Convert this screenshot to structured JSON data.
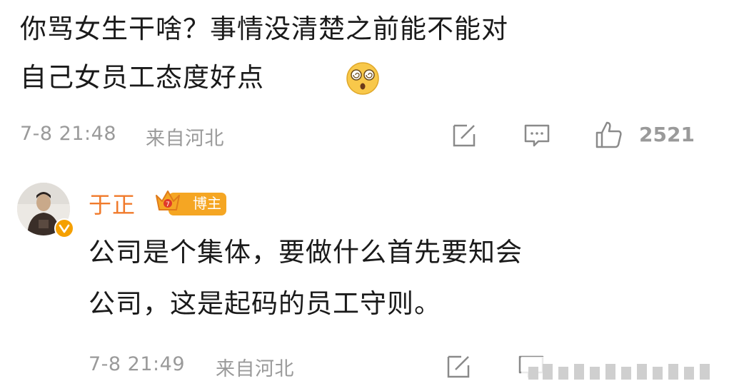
{
  "top_comment": {
    "line1": "你骂女生干啥？事情没清楚之前能不能对",
    "line2": "自己女员工态度好点",
    "emoji": "dizzy-face-icon",
    "timestamp": "7-8 21:48",
    "location": "来自河北",
    "like_count": "2521"
  },
  "reply": {
    "username": "于正",
    "badge_label": "博主",
    "line1": "公司是个集体，要做什么首先要知会",
    "line2": "公司，这是起码的员工守则。",
    "timestamp": "7-8 21:49",
    "location": "来自河北"
  },
  "colors": {
    "username": "#f07a2b",
    "badge": "#f5a623",
    "meta": "#9a9a9a"
  }
}
